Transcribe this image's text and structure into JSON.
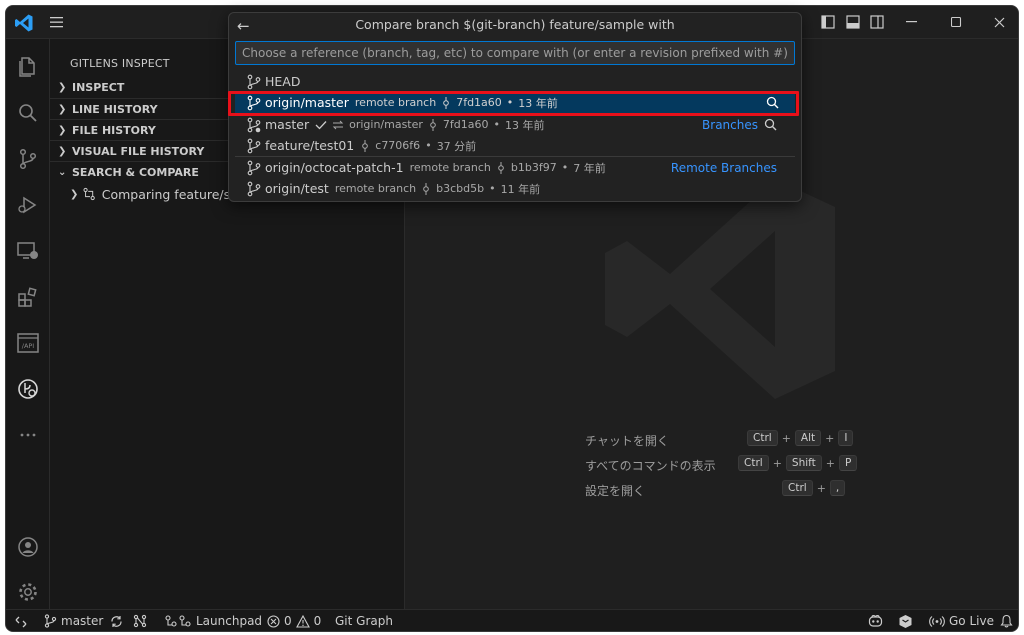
{
  "quickpick": {
    "title": "Compare branch $(git-branch) feature/sample with",
    "placeholder": "Choose a reference (branch, tag, etc) to compare with (or enter a revision prefixed with #)",
    "items": [
      {
        "label": "HEAD"
      },
      {
        "label": "origin/master",
        "type": "remote branch",
        "sha": "7fd1a60",
        "age": "13 年前"
      },
      {
        "label": "master",
        "upstream": "origin/master",
        "sha": "7fd1a60",
        "age": "13 年前",
        "group": "Branches"
      },
      {
        "label": "feature/test01",
        "sha": "c7706f6",
        "age": "37 分前"
      },
      {
        "label": "origin/octocat-patch-1",
        "type": "remote branch",
        "sha": "b1b3f97",
        "age": "7 年前",
        "group": "Remote Branches"
      },
      {
        "label": "origin/test",
        "type": "remote branch",
        "sha": "b3cbd5b",
        "age": "11 年前"
      }
    ]
  },
  "sidebar": {
    "title": "GITLENS INSPECT",
    "sections": [
      "INSPECT",
      "LINE HISTORY",
      "FILE HISTORY",
      "VISUAL FILE HISTORY",
      "SEARCH & COMPARE"
    ],
    "compare_item": "Comparing feature/sam"
  },
  "editor": {
    "shortcuts": [
      {
        "label": "チャットを開く",
        "keys": [
          "Ctrl",
          "Alt",
          "I"
        ]
      },
      {
        "label": "すべてのコマンドの表示",
        "keys": [
          "Ctrl",
          "Shift",
          "P"
        ]
      },
      {
        "label": "設定を開く",
        "keys": [
          "Ctrl",
          ","
        ]
      }
    ]
  },
  "statusbar": {
    "branch": "master",
    "launchpad": "Launchpad",
    "errors": "0",
    "warnings": "0",
    "git_graph": "Git Graph",
    "go_live": "Go Live"
  },
  "colors": {
    "accent": "#0078d4",
    "selection": "#04395e",
    "highlight_box": "#e8101a",
    "link": "#3794ff"
  }
}
